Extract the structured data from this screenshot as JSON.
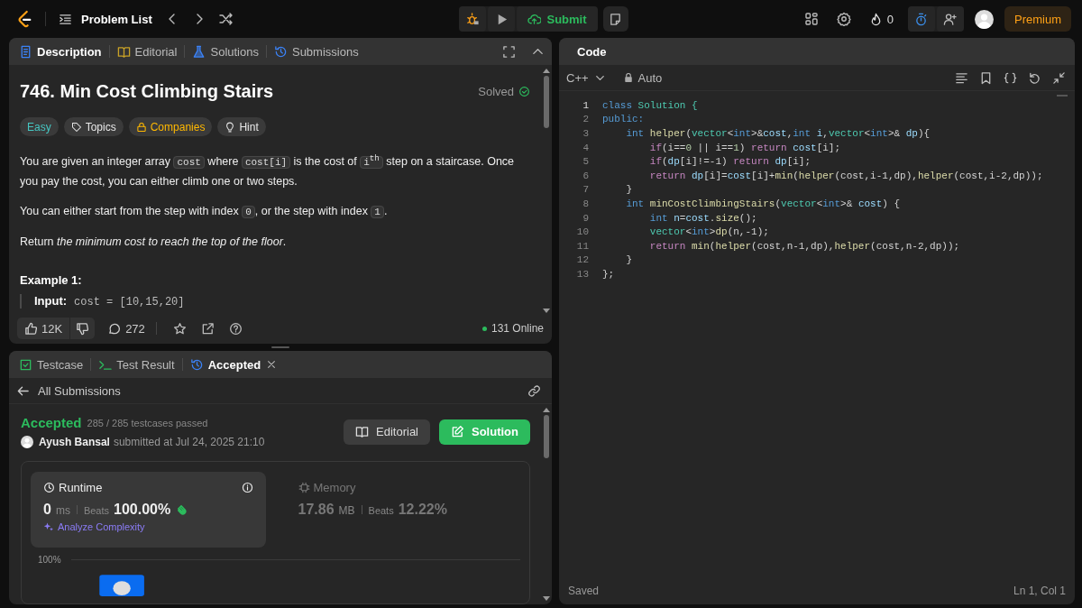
{
  "header": {
    "title": "Problem List",
    "submit": "Submit",
    "streak": "0",
    "premium": "Premium"
  },
  "description": {
    "tabs": [
      {
        "label": "Description",
        "selected": true
      },
      {
        "label": "Editorial",
        "selected": false
      },
      {
        "label": "Solutions",
        "selected": false
      },
      {
        "label": "Submissions",
        "selected": false
      }
    ],
    "title": "746. Min Cost Climbing Stairs",
    "status": "Solved",
    "tags": [
      {
        "label": "Easy",
        "kind": "difficulty"
      },
      {
        "label": "Topics",
        "kind": "topics"
      },
      {
        "label": "Companies",
        "kind": "companies"
      },
      {
        "label": "Hint",
        "kind": "hint"
      }
    ],
    "paragraphs": [
      [
        {
          "kind": "text",
          "text": "You are given an integer array "
        },
        {
          "kind": "code",
          "text": "cost"
        },
        {
          "kind": "text",
          "text": " where "
        },
        {
          "kind": "code",
          "text": "cost[i]"
        },
        {
          "kind": "text",
          "text": " is the cost of "
        },
        {
          "kind": "code",
          "text": "i$^{th}$"
        },
        {
          "kind": "text",
          "text": " step on a staircase. Once you pay the cost, you can either climb one or two steps."
        }
      ],
      [
        {
          "kind": "text",
          "text": "You can either start from the step with index "
        },
        {
          "kind": "code",
          "text": "0"
        },
        {
          "kind": "text",
          "text": ", or the step with index "
        },
        {
          "kind": "code",
          "text": "1"
        },
        {
          "kind": "text",
          "text": "."
        }
      ],
      [
        {
          "kind": "text",
          "text": "Return "
        },
        {
          "kind": "italic",
          "text": "the minimum cost to reach the top of the floor"
        },
        {
          "kind": "text",
          "text": "."
        }
      ]
    ],
    "example_title": "Example 1:",
    "example_input_label": "Input:",
    "example_input_value": "cost = [10,15,20]"
  },
  "footer": {
    "likes": "12K",
    "comments": "272",
    "online": "131 Online"
  },
  "console": {
    "tabs": [
      {
        "label": "Testcase",
        "selected": false,
        "closable": false
      },
      {
        "label": "Test Result",
        "selected": false,
        "closable": false
      },
      {
        "label": "Accepted",
        "selected": true,
        "closable": true
      }
    ],
    "back": "All Submissions",
    "result": {
      "status": "Accepted",
      "cases": "285 / 285 testcases passed",
      "user": "Ayush Bansal",
      "submitted": "submitted at Jul 24, 2025 21:10"
    },
    "buttons": [
      {
        "label": "Editorial",
        "kind": "secondary"
      },
      {
        "label": "Solution",
        "kind": "primary"
      }
    ],
    "metrics": [
      {
        "title": "Runtime",
        "value": "0",
        "unit": "ms",
        "beats_label": "Beats",
        "beats": "100.00%",
        "selected": true,
        "analyze": "Analyze Complexity"
      },
      {
        "title": "Memory",
        "value": "17.86",
        "unit": "MB",
        "beats_label": "Beats",
        "beats": "12.22%",
        "selected": false
      }
    ],
    "chart_label": "100%"
  },
  "editor": {
    "title": "Code",
    "language": "C++",
    "mode": "Auto",
    "status": "Saved",
    "cursor": "Ln 1, Col 1",
    "lines": [
      {
        "number": "1",
        "tokens": [
          {
            "text": "class ",
            "kind": "keyword"
          },
          {
            "text": "Solution {",
            "kind": "type"
          }
        ]
      },
      {
        "number": "2",
        "tokens": [
          {
            "text": "public:",
            "kind": "keyword"
          }
        ],
        "children": [
          {
            "number": "3",
            "tokens": [
              {
                "text": "int ",
                "kind": "keyword"
              },
              {
                "text": "helper",
                "kind": "function"
              },
              {
                "text": "(",
                "kind": "plain"
              },
              {
                "text": "vector",
                "kind": "type"
              },
              {
                "text": "<",
                "kind": "plain"
              },
              {
                "text": "int",
                "kind": "keyword"
              },
              {
                "text": ">&",
                "kind": "plain"
              },
              {
                "text": "cost",
                "kind": "variable"
              },
              {
                "text": ",",
                "kind": "plain"
              },
              {
                "text": "int ",
                "kind": "keyword"
              },
              {
                "text": "i",
                "kind": "variable"
              },
              {
                "text": ",",
                "kind": "plain"
              },
              {
                "text": "vector",
                "kind": "type"
              },
              {
                "text": "<",
                "kind": "plain"
              },
              {
                "text": "int",
                "kind": "keyword"
              },
              {
                "text": ">& ",
                "kind": "plain"
              },
              {
                "text": "dp",
                "kind": "variable"
              },
              {
                "text": "){",
                "kind": "plain"
              }
            ],
            "children": [
              {
                "number": "4",
                "tokens": [
                  {
                    "text": "if",
                    "kind": "control"
                  },
                  {
                    "text": "(i==",
                    "kind": "plain"
                  },
                  {
                    "text": "0",
                    "kind": "number"
                  },
                  {
                    "text": " || i==",
                    "kind": "plain"
                  },
                  {
                    "text": "1",
                    "kind": "number"
                  },
                  {
                    "text": ") ",
                    "kind": "plain"
                  },
                  {
                    "text": "return ",
                    "kind": "control"
                  },
                  {
                    "text": "cost",
                    "kind": "variable"
                  },
                  {
                    "text": "[i];",
                    "kind": "plain"
                  }
                ]
              },
              {
                "number": "5",
                "tokens": [
                  {
                    "text": "if",
                    "kind": "control"
                  },
                  {
                    "text": "(",
                    "kind": "plain"
                  },
                  {
                    "text": "dp",
                    "kind": "variable"
                  },
                  {
                    "text": "[i]!=-1) ",
                    "kind": "plain"
                  },
                  {
                    "text": "return ",
                    "kind": "control"
                  },
                  {
                    "text": "dp",
                    "kind": "variable"
                  },
                  {
                    "text": "[i];",
                    "kind": "plain"
                  }
                ]
              },
              {
                "number": "6",
                "tokens": [
                  {
                    "text": "return ",
                    "kind": "control"
                  },
                  {
                    "text": "dp",
                    "kind": "variable"
                  },
                  {
                    "text": "[i]=",
                    "kind": "plain"
                  },
                  {
                    "text": "cost",
                    "kind": "variable"
                  },
                  {
                    "text": "[i]+",
                    "kind": "plain"
                  },
                  {
                    "text": "min",
                    "kind": "function"
                  },
                  {
                    "text": "(",
                    "kind": "plain"
                  },
                  {
                    "text": "helper",
                    "kind": "function"
                  },
                  {
                    "text": "(cost,i-1,dp),",
                    "kind": "plain"
                  },
                  {
                    "text": "helper",
                    "kind": "function"
                  },
                  {
                    "text": "(cost,i-2,dp));",
                    "kind": "plain"
                  }
                ]
              }
            ]
          },
          {
            "number": "7",
            "tokens": [
              {
                "text": "}",
                "kind": "plain"
              }
            ]
          },
          {
            "number": "8",
            "tokens": [
              {
                "text": "int ",
                "kind": "keyword"
              },
              {
                "text": "minCostClimbingStairs",
                "kind": "function"
              },
              {
                "text": "(",
                "kind": "plain"
              },
              {
                "text": "vector",
                "kind": "type"
              },
              {
                "text": "<",
                "kind": "plain"
              },
              {
                "text": "int",
                "kind": "keyword"
              },
              {
                "text": ">& ",
                "kind": "plain"
              },
              {
                "text": "cost",
                "kind": "variable"
              },
              {
                "text": ") {",
                "kind": "plain"
              }
            ],
            "children": [
              {
                "number": "9",
                "tokens": [
                  {
                    "text": "int ",
                    "kind": "keyword"
                  },
                  {
                    "text": "n",
                    "kind": "variable"
                  },
                  {
                    "text": "=",
                    "kind": "plain"
                  },
                  {
                    "text": "cost",
                    "kind": "variable"
                  },
                  {
                    "text": ".",
                    "kind": "plain"
                  },
                  {
                    "text": "size",
                    "kind": "function"
                  },
                  {
                    "text": "();",
                    "kind": "plain"
                  }
                ]
              },
              {
                "number": "10",
                "tokens": [
                  {
                    "text": "vector",
                    "kind": "type"
                  },
                  {
                    "text": "<",
                    "kind": "plain"
                  },
                  {
                    "text": "int",
                    "kind": "keyword"
                  },
                  {
                    "text": ">",
                    "kind": "plain"
                  },
                  {
                    "text": "dp",
                    "kind": "function"
                  },
                  {
                    "text": "(n,-1);",
                    "kind": "plain"
                  }
                ]
              },
              {
                "number": "11",
                "tokens": [
                  {
                    "text": "return ",
                    "kind": "control"
                  },
                  {
                    "text": "min",
                    "kind": "function"
                  },
                  {
                    "text": "(",
                    "kind": "plain"
                  },
                  {
                    "text": "helper",
                    "kind": "function"
                  },
                  {
                    "text": "(cost,n-1,dp),",
                    "kind": "plain"
                  },
                  {
                    "text": "helper",
                    "kind": "function"
                  },
                  {
                    "text": "(cost,n-2,dp));",
                    "kind": "plain"
                  }
                ]
              }
            ]
          },
          {
            "number": "12",
            "tokens": [
              {
                "text": "}",
                "kind": "plain"
              }
            ]
          }
        ]
      },
      {
        "number": "13",
        "tokens": [
          {
            "text": "};",
            "kind": "plain"
          }
        ]
      }
    ]
  }
}
